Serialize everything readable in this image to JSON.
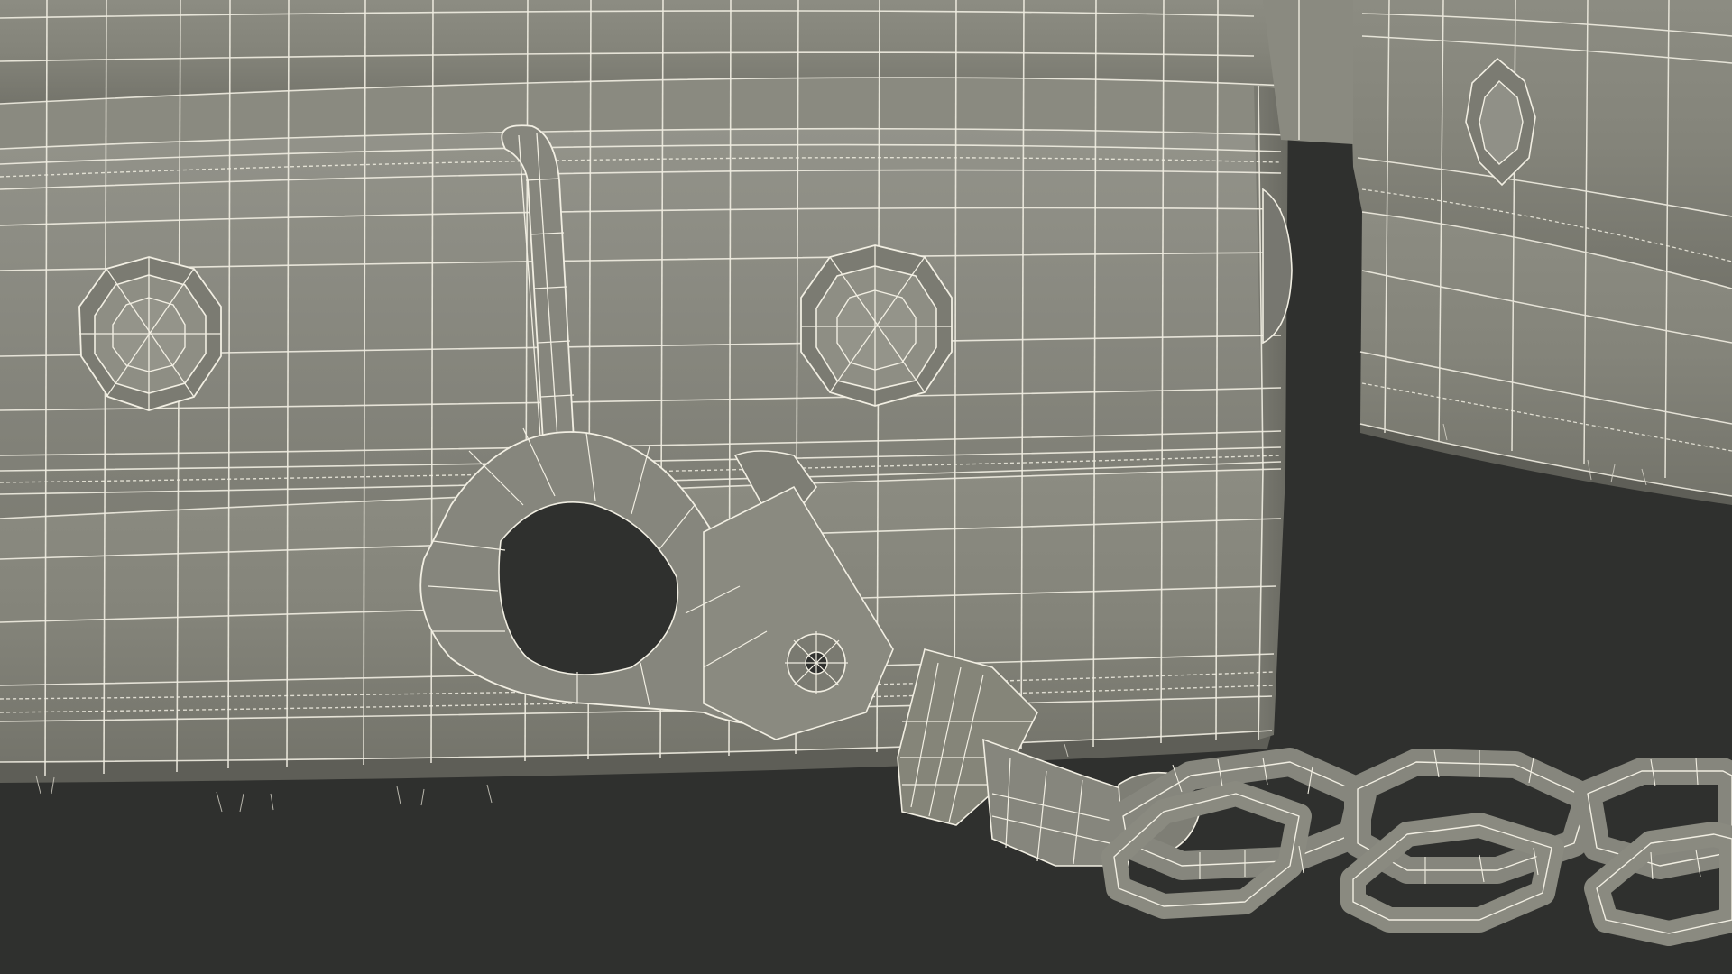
{
  "scene": {
    "background_color": "#2f302e",
    "surface_color": "#85857b",
    "surface_shadow_color": "#6c6c63",
    "surface_highlight_color": "#9b9b90",
    "wire_color": "#f1eee2",
    "objects": [
      "shackle-cuff-main",
      "shackle-cuff-secondary",
      "leather-strap-with-rivets",
      "snap-hook",
      "chain-links"
    ]
  }
}
